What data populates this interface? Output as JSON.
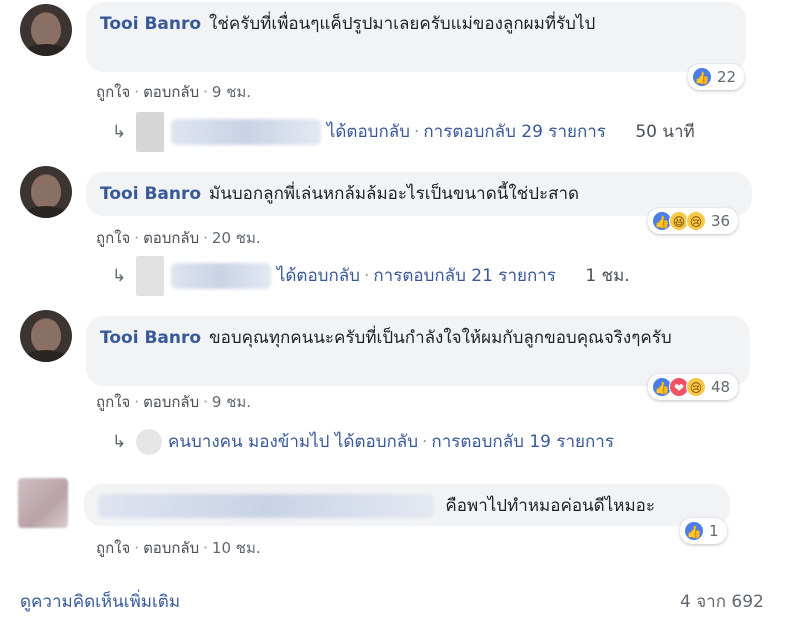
{
  "comments": [
    {
      "author": "Tooi Banro",
      "text": "ใช่ครับที่เพื่อนๆแค็ปรูปมาเลยครับแม่ของลูกผมที่รับไป",
      "like": "ถูกใจ",
      "reply": "ตอบกลับ",
      "time": "9 ชม.",
      "reaction_count": "22",
      "replies": {
        "text": "ได้ตอบกลับ",
        "count_text": "การตอบกลับ 29 รายการ",
        "time": "50 นาที"
      }
    },
    {
      "author": "Tooi Banro",
      "text": "มันบอกลูกพี่เล่นหกล้มล้มอะไรเป็นขนาดนี้ใช่ปะสาด",
      "like": "ถูกใจ",
      "reply": "ตอบกลับ",
      "time": "20 ชม.",
      "reaction_count": "36",
      "replies": {
        "text": "ได้ตอบกลับ",
        "count_text": "การตอบกลับ 21 รายการ",
        "time": "1 ชม."
      }
    },
    {
      "author": "Tooi Banro",
      "text": "ขอบคุณทุกคนนะครับที่เป็นกำลังใจให้ผมกับลูกขอบคุณจริงๆครับ",
      "like": "ถูกใจ",
      "reply": "ตอบกลับ",
      "time": "9 ชม.",
      "reaction_count": "48",
      "replies": {
        "name": "คนบางคน มองข้ามไป",
        "text": "ได้ตอบกลับ",
        "count_text": "การตอบกลับ 19 รายการ"
      }
    },
    {
      "text": "คือพาไปทำหมอค่อนดีไหมอะ",
      "like": "ถูกใจ",
      "reply": "ตอบกลับ",
      "time": "10 ชม.",
      "reaction_count": "1"
    }
  ],
  "footer": {
    "more_comments": "ดูความคิดเห็นเพิ่มเติม",
    "pagination": "4 จาก 692"
  },
  "colors": {
    "link": "#385898",
    "bubble": "#f2f3f5",
    "meta": "#606770"
  }
}
